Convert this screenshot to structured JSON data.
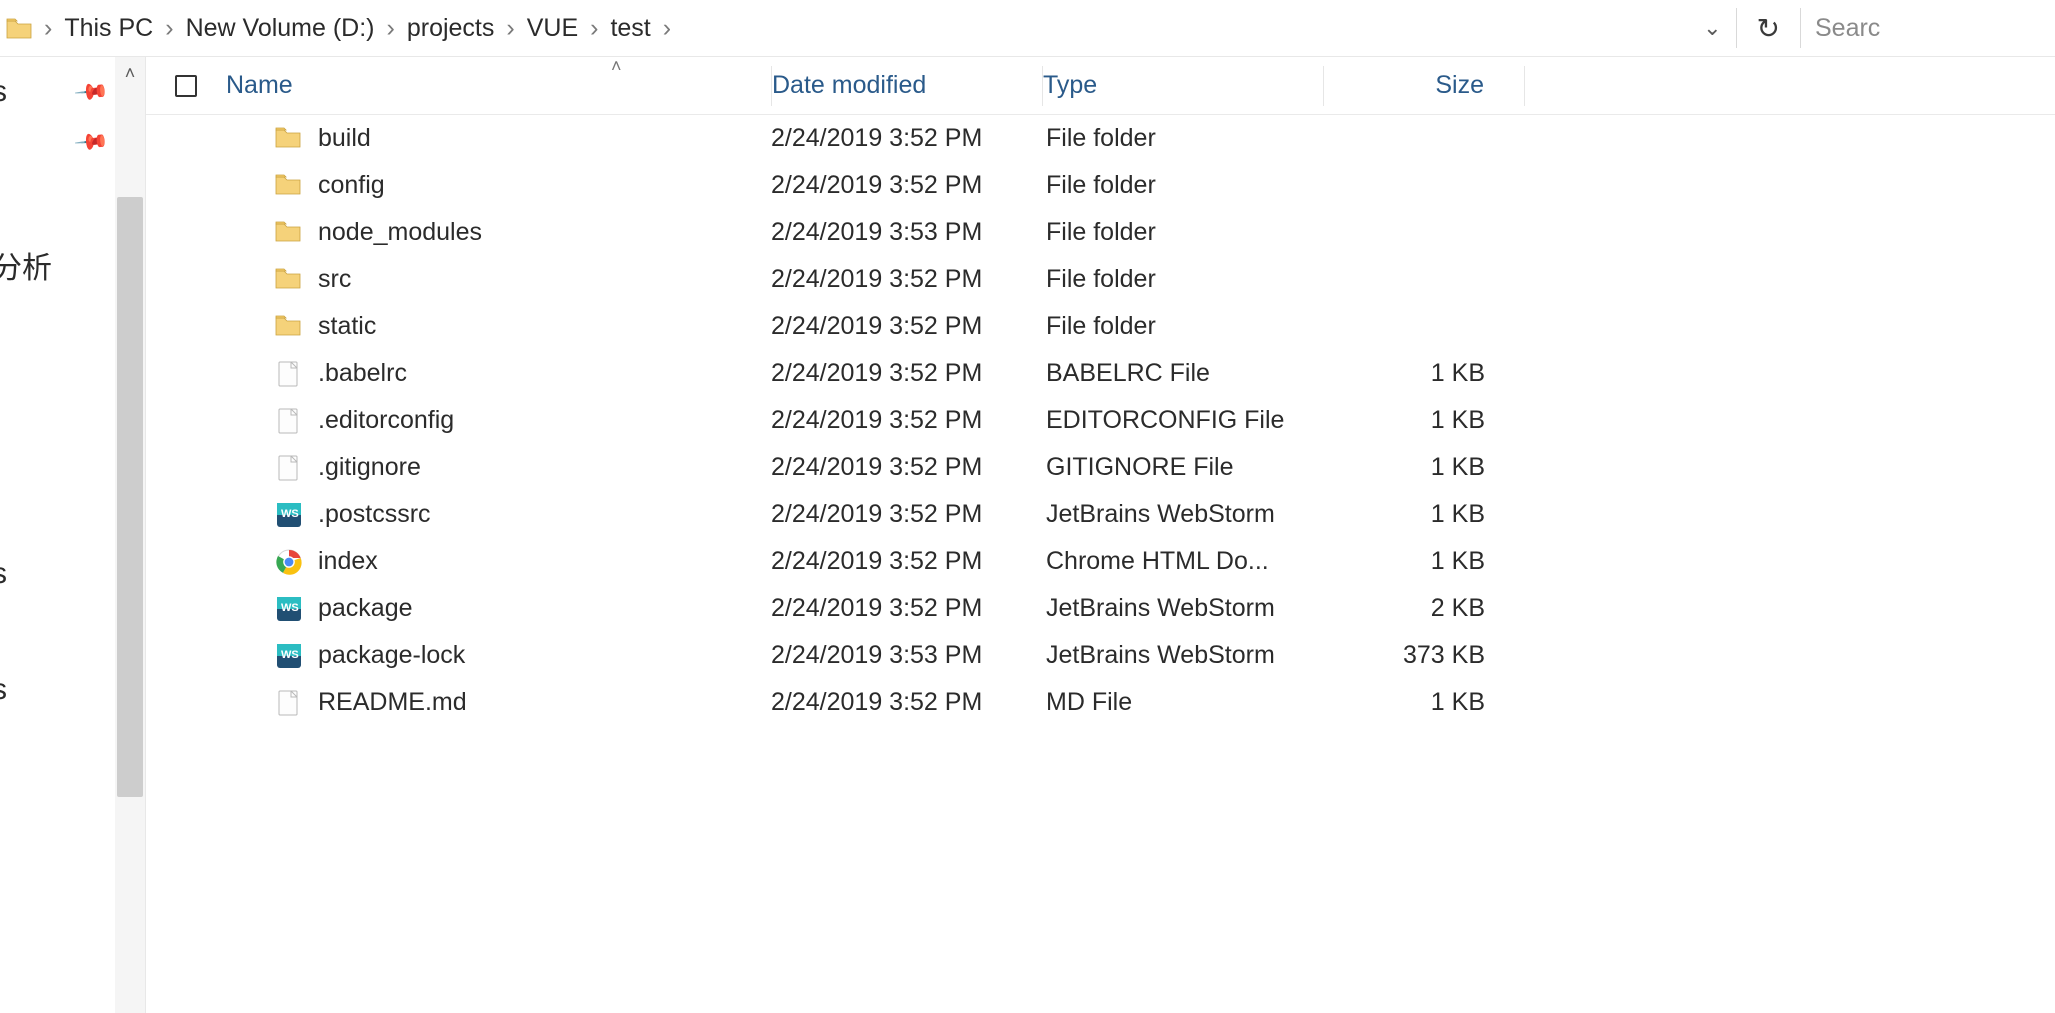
{
  "addr": {
    "crumbs": [
      "This PC",
      "New Volume (D:)",
      "projects",
      "VUE",
      "test"
    ],
    "search_placeholder": "Searc"
  },
  "sidebar": {
    "labels": {
      "l1": "s",
      "l2": "分析",
      "l3": "s",
      "l4": "s"
    }
  },
  "columns": {
    "name": "Name",
    "date": "Date modified",
    "type": "Type",
    "size": "Size"
  },
  "rows": [
    {
      "icon": "folder",
      "name": "build",
      "date": "2/24/2019 3:52 PM",
      "type": "File folder",
      "size": ""
    },
    {
      "icon": "folder",
      "name": "config",
      "date": "2/24/2019 3:52 PM",
      "type": "File folder",
      "size": ""
    },
    {
      "icon": "folder",
      "name": "node_modules",
      "date": "2/24/2019 3:53 PM",
      "type": "File folder",
      "size": ""
    },
    {
      "icon": "folder",
      "name": "src",
      "date": "2/24/2019 3:52 PM",
      "type": "File folder",
      "size": ""
    },
    {
      "icon": "folder",
      "name": "static",
      "date": "2/24/2019 3:52 PM",
      "type": "File folder",
      "size": ""
    },
    {
      "icon": "file",
      "name": ".babelrc",
      "date": "2/24/2019 3:52 PM",
      "type": "BABELRC File",
      "size": "1 KB"
    },
    {
      "icon": "file",
      "name": ".editorconfig",
      "date": "2/24/2019 3:52 PM",
      "type": "EDITORCONFIG File",
      "size": "1 KB"
    },
    {
      "icon": "file",
      "name": ".gitignore",
      "date": "2/24/2019 3:52 PM",
      "type": "GITIGNORE File",
      "size": "1 KB"
    },
    {
      "icon": "ws",
      "name": ".postcssrc",
      "date": "2/24/2019 3:52 PM",
      "type": "JetBrains WebStorm",
      "size": "1 KB"
    },
    {
      "icon": "chrome",
      "name": "index",
      "date": "2/24/2019 3:52 PM",
      "type": "Chrome HTML Do...",
      "size": "1 KB"
    },
    {
      "icon": "ws",
      "name": "package",
      "date": "2/24/2019 3:52 PM",
      "type": "JetBrains WebStorm",
      "size": "2 KB"
    },
    {
      "icon": "ws",
      "name": "package-lock",
      "date": "2/24/2019 3:53 PM",
      "type": "JetBrains WebStorm",
      "size": "373 KB"
    },
    {
      "icon": "file",
      "name": "README.md",
      "date": "2/24/2019 3:52 PM",
      "type": "MD File",
      "size": "1 KB"
    }
  ]
}
